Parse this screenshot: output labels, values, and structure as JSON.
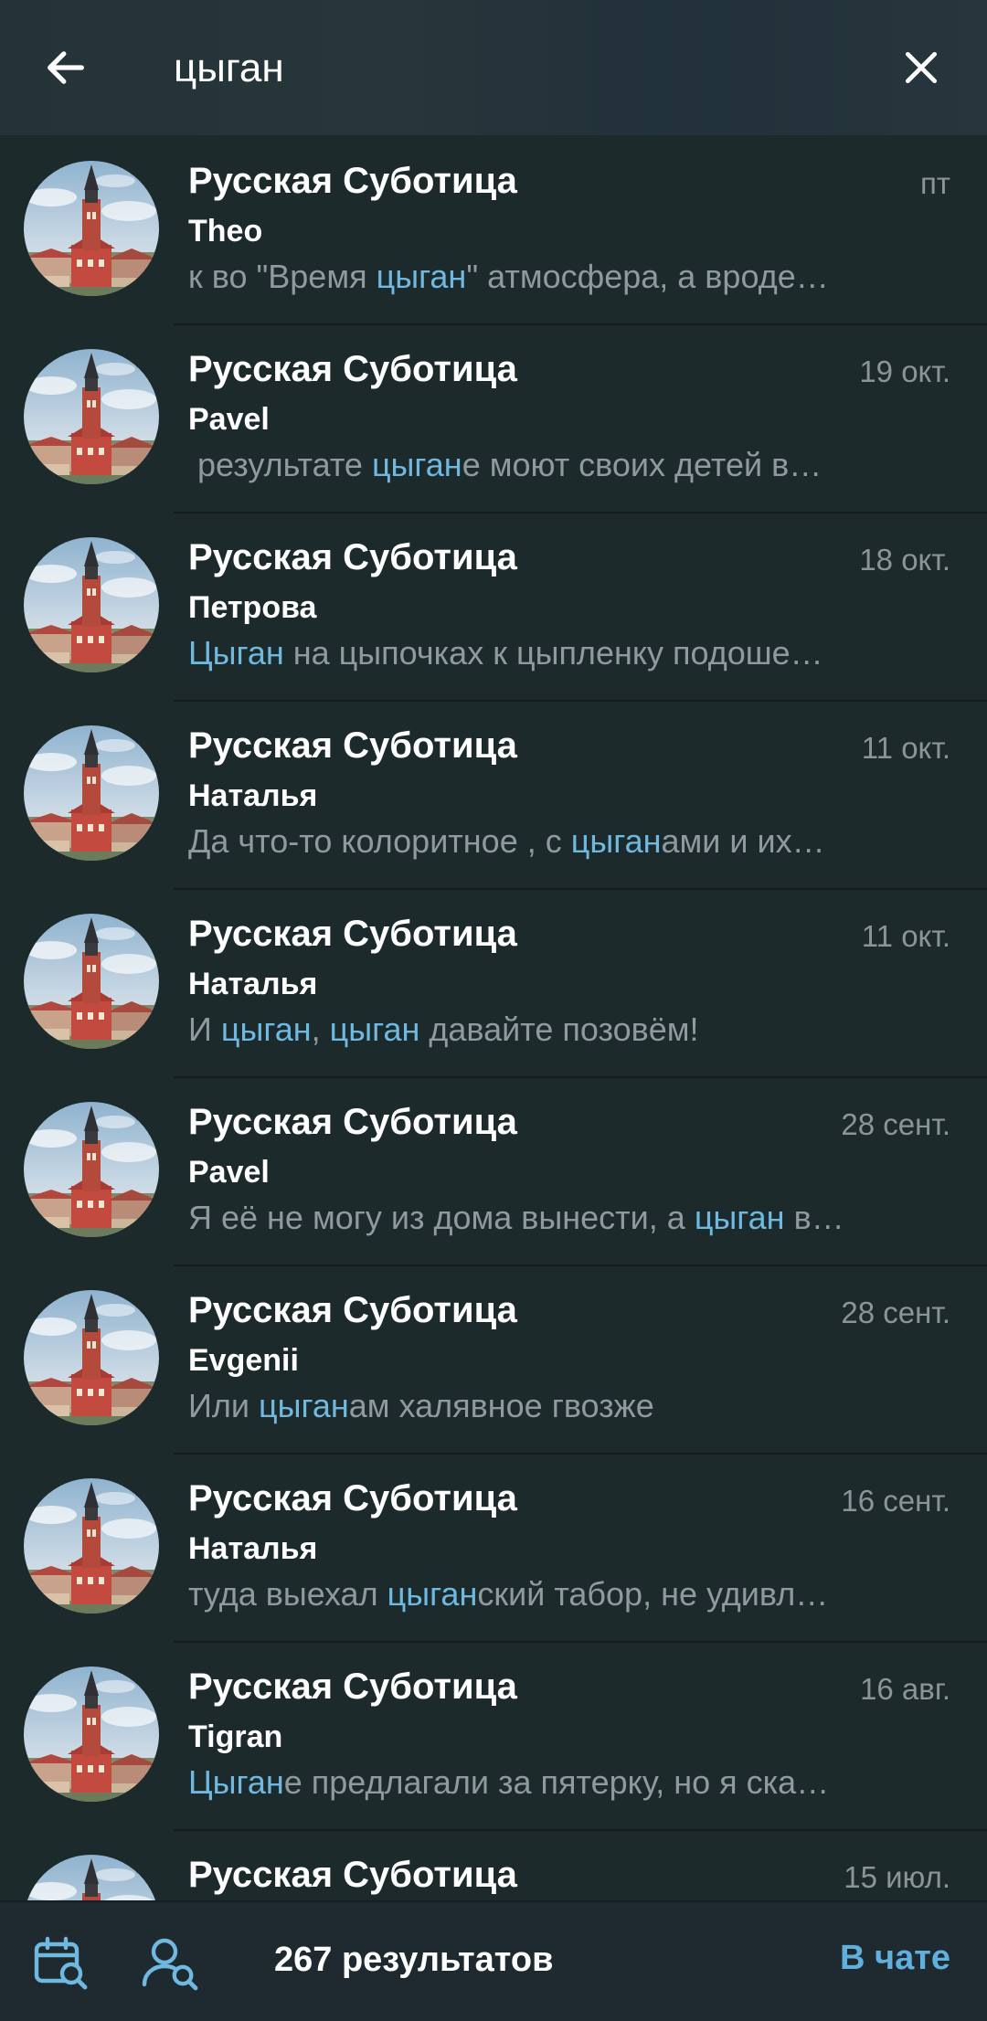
{
  "search": {
    "query": "цыган",
    "back_icon": "arrow-left-icon",
    "clear_icon": "close-icon"
  },
  "colors": {
    "highlight": "#6fb8e0",
    "accent": "#5fb0dc",
    "background": "#1d2a2c"
  },
  "results": [
    {
      "title": "Русская Суботица",
      "date": "пт",
      "sender": "Theo",
      "snippet": [
        {
          "t": "к во \"Время ",
          "h": false
        },
        {
          "t": "цыган",
          "h": true
        },
        {
          "t": "\" атмосфера, а вроде…",
          "h": false
        }
      ]
    },
    {
      "title": "Русская Суботица",
      "date": "19 окт.",
      "sender": "Pavel",
      "snippet": [
        {
          "t": " результате ",
          "h": false
        },
        {
          "t": "цыган",
          "h": true
        },
        {
          "t": "е моют своих детей в…",
          "h": false
        }
      ]
    },
    {
      "title": "Русская Суботица",
      "date": "18 окт.",
      "sender": "Петрова",
      "snippet": [
        {
          "t": "Цыган",
          "h": true
        },
        {
          "t": " на цыпочках к цыпленку подоше…",
          "h": false
        }
      ]
    },
    {
      "title": "Русская Суботица",
      "date": "11 окт.",
      "sender": "Наталья",
      "snippet": [
        {
          "t": "Да что-то колоритное , с ",
          "h": false
        },
        {
          "t": "цыган",
          "h": true
        },
        {
          "t": "ами и их…",
          "h": false
        }
      ]
    },
    {
      "title": "Русская Суботица",
      "date": "11 окт.",
      "sender": "Наталья",
      "snippet": [
        {
          "t": "И ",
          "h": false
        },
        {
          "t": "цыган",
          "h": true
        },
        {
          "t": ", ",
          "h": false
        },
        {
          "t": "цыган",
          "h": true
        },
        {
          "t": " давайте позовём!",
          "h": false
        }
      ]
    },
    {
      "title": "Русская Суботица",
      "date": "28 сент.",
      "sender": "Pavel",
      "snippet": [
        {
          "t": "Я её не могу из дома вынести, а ",
          "h": false
        },
        {
          "t": "цыган",
          "h": true
        },
        {
          "t": " в…",
          "h": false
        }
      ]
    },
    {
      "title": "Русская Суботица",
      "date": "28 сент.",
      "sender": "Evgenii",
      "snippet": [
        {
          "t": "Или ",
          "h": false
        },
        {
          "t": "цыган",
          "h": true
        },
        {
          "t": "ам халявное гвозже",
          "h": false
        }
      ]
    },
    {
      "title": "Русская Суботица",
      "date": "16 сент.",
      "sender": "Наталья",
      "snippet": [
        {
          "t": "туда выехал ",
          "h": false
        },
        {
          "t": "цыган",
          "h": true
        },
        {
          "t": "ский табор, не удивл…",
          "h": false
        }
      ]
    },
    {
      "title": "Русская Суботица",
      "date": "16 авг.",
      "sender": "Tigran",
      "snippet": [
        {
          "t": "Цыган",
          "h": true
        },
        {
          "t": "е предлагали за пятерку, но я ска…",
          "h": false
        }
      ]
    },
    {
      "title": "Русская Суботица",
      "date": "15 июл.",
      "sender": "",
      "snippet": []
    }
  ],
  "bottom_bar": {
    "calendar_icon": "calendar-search-icon",
    "user_icon": "user-search-icon",
    "count_label": "267 результатов",
    "in_chat_label": "В чате"
  }
}
